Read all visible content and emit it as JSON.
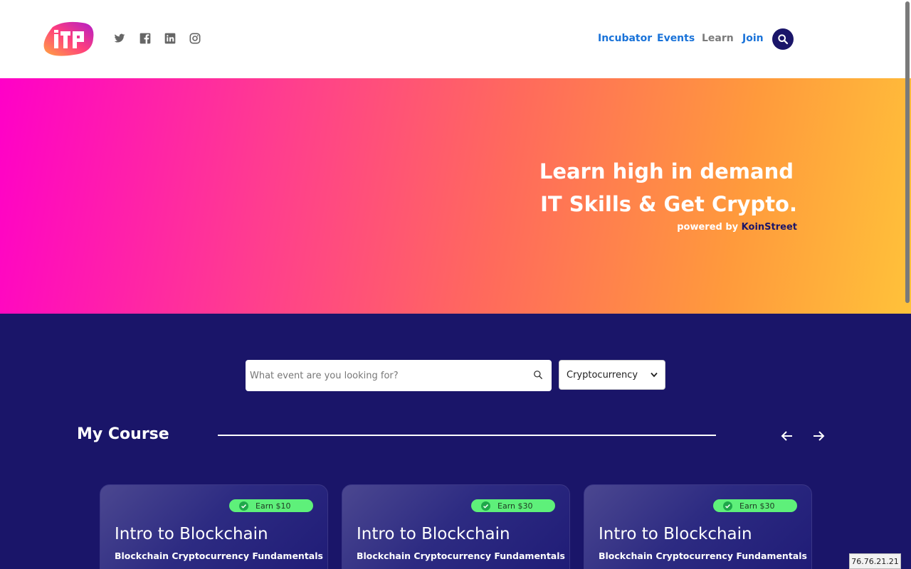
{
  "colors": {
    "navy": "#1a1569",
    "link": "#1a73d9",
    "badge_green": "#5ef07a"
  },
  "header": {
    "logo_text": "ITP",
    "social_icons": [
      "twitter-icon",
      "facebook-icon",
      "linkedin-icon",
      "instagram-icon"
    ],
    "nav": [
      {
        "label": "Incubator"
      },
      {
        "label": "Events"
      },
      {
        "label": "Learn"
      },
      {
        "label": "Join"
      }
    ]
  },
  "hero": {
    "line1": "Learn high in demand",
    "line2": "IT Skills & Get Crypto.",
    "powered_prefix": "powered by",
    "powered_brand": "KoinStreet"
  },
  "search": {
    "placeholder": "What event are you looking for?",
    "category_selected": "Cryptocurrency"
  },
  "section": {
    "title": "My Course"
  },
  "cards": [
    {
      "badge": "Earn $10",
      "title": "Intro to Blockchain",
      "subtitle": "Blockchain Cryptocurrency Fundamentals"
    },
    {
      "badge": "Earn $30",
      "title": "Intro to Blockchain",
      "subtitle": "Blockchain Cryptocurrency Fundamentals"
    },
    {
      "badge": "Earn $30",
      "title": "Intro to Blockchain",
      "subtitle": "Blockchain Cryptocurrency Fundamentals"
    }
  ],
  "ip_address": "76.76.21.21"
}
